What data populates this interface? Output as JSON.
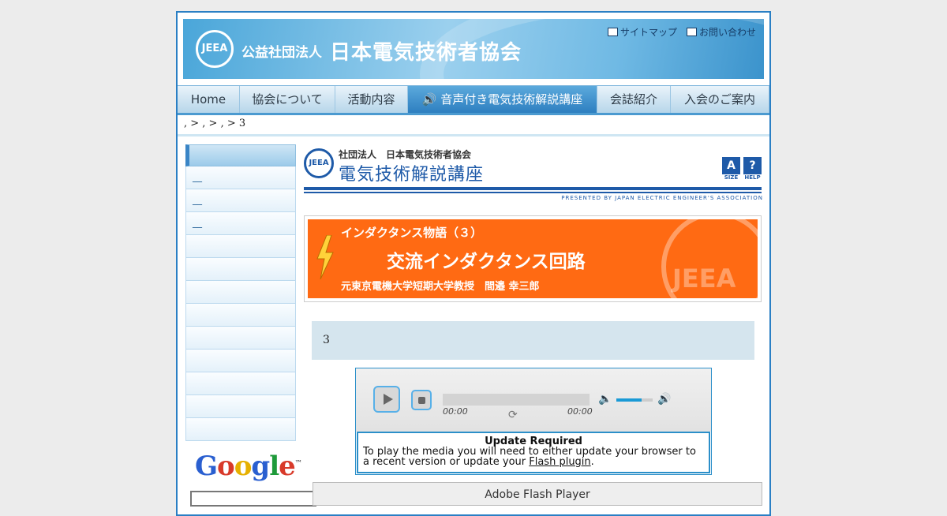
{
  "header": {
    "logo_text": "JEEA",
    "org_prefix": "公益社団法人",
    "org_name": "日本電気技術者協会",
    "links": [
      "サイトマップ",
      "お問い合わせ"
    ]
  },
  "nav": {
    "items": [
      {
        "label": "Home"
      },
      {
        "label": "協会について"
      },
      {
        "label": "活動内容"
      },
      {
        "label": "🔊 音声付き電気技術解説講座"
      },
      {
        "label": "会誌紹介"
      },
      {
        "label": "入会のご案内"
      }
    ],
    "active_index": 3
  },
  "breadcrumb": ", > , > , > 3",
  "sidebar": {
    "items": [
      "__",
      "__",
      "__",
      "",
      "",
      "",
      "",
      "",
      "",
      "",
      "",
      ""
    ]
  },
  "google": {
    "logo": "Google",
    "tm": "™"
  },
  "lecture": {
    "logo_text": "JEEA",
    "org_small": "社団法人　日本電気技術者協会",
    "title": "電気技術解説講座",
    "presented": "PRESENTED BY JAPAN ELECTRIC ENGINEER'S ASSOCIATION",
    "size_label": "SIZE",
    "help_label": "HELP"
  },
  "banner": {
    "series": "インダクタンス物語（３）",
    "title": "交流インダクタンス回路",
    "author": "元東京電機大学短期大学教授　間邉 幸三郎",
    "watermark": "JEEA"
  },
  "chapter": {
    "label": "3"
  },
  "player": {
    "current_time": "00:00",
    "duration": "00:00",
    "volume": 0.7,
    "update_title": "Update Required",
    "update_text": "To play the media you will need to either update your browser to a recent version or update your ",
    "update_link": "Flash plugin",
    "update_end": "."
  },
  "flash_bar": "Adobe Flash Player"
}
